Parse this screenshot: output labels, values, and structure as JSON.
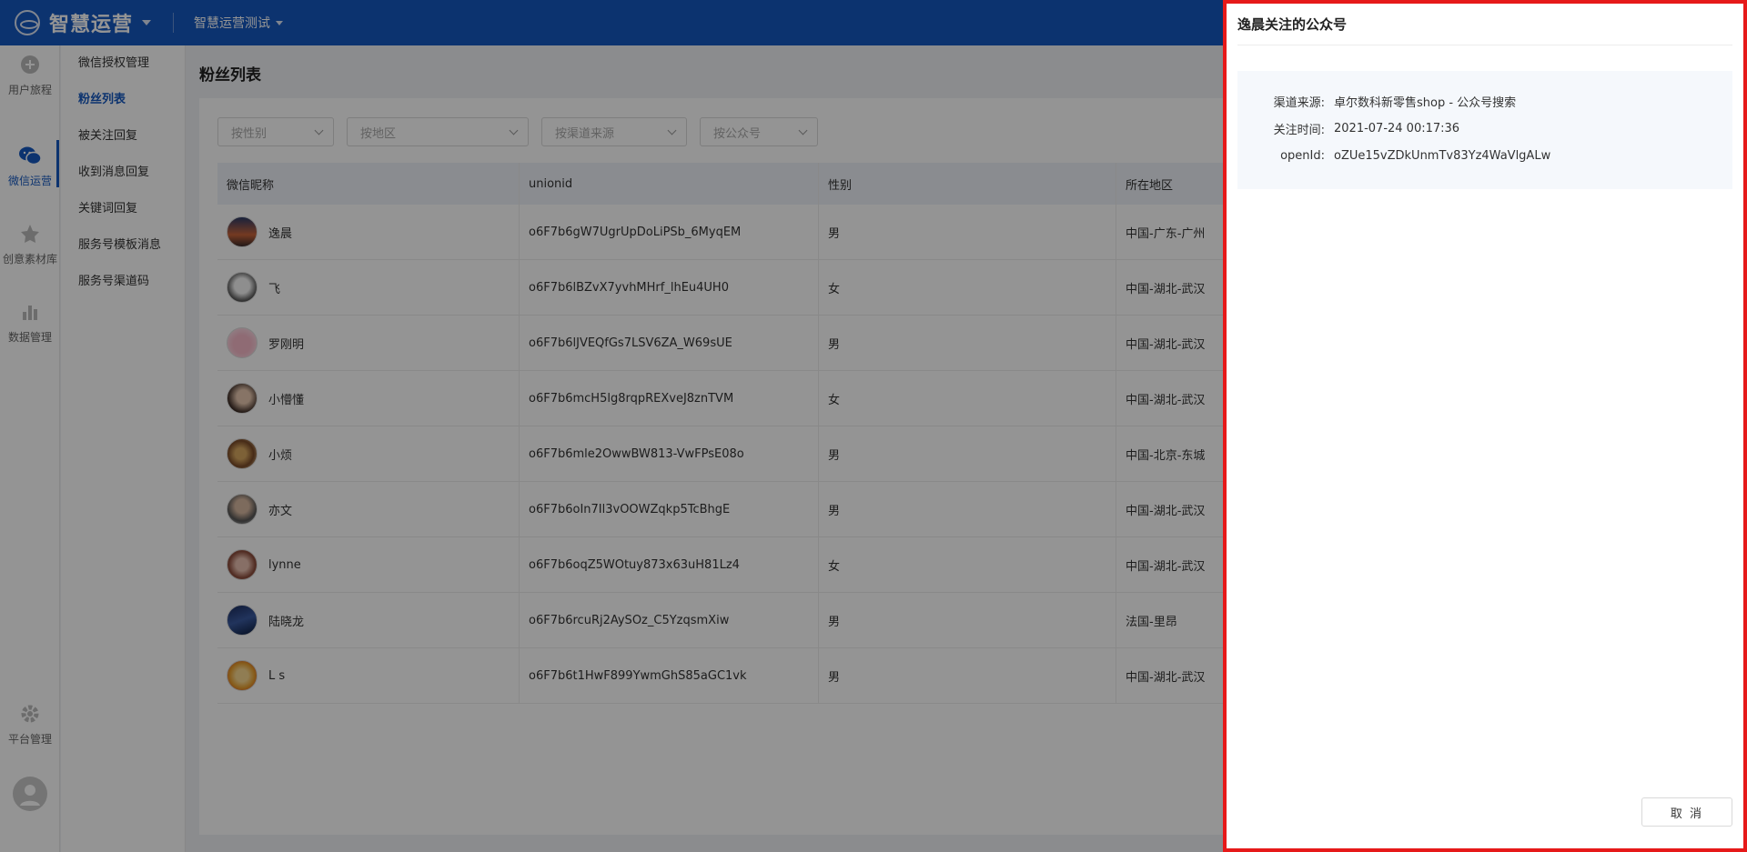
{
  "app": {
    "name": "智慧运营",
    "project": "智慧运营测试"
  },
  "rail": [
    {
      "label": "用户旅程",
      "icon": "journey-icon"
    },
    {
      "label": "微信运营",
      "icon": "wechat-icon",
      "active": true
    },
    {
      "label": "创意素材库",
      "icon": "creative-icon"
    },
    {
      "label": "数据管理",
      "icon": "bar-chart-icon"
    },
    {
      "label": "平台管理",
      "icon": "gear-icon"
    }
  ],
  "submenu": [
    {
      "label": "微信授权管理"
    },
    {
      "label": "粉丝列表",
      "active": true
    },
    {
      "label": "被关注回复"
    },
    {
      "label": "收到消息回复"
    },
    {
      "label": "关键词回复"
    },
    {
      "label": "服务号模板消息"
    },
    {
      "label": "服务号渠道码"
    }
  ],
  "page": {
    "title": "粉丝列表"
  },
  "filters": [
    {
      "placeholder": "按性别"
    },
    {
      "placeholder": "按地区"
    },
    {
      "placeholder": "按渠道来源"
    },
    {
      "placeholder": "按公众号"
    }
  ],
  "table": {
    "headers": [
      "微信昵称",
      "unionid",
      "性别",
      "所在地区"
    ],
    "rows": [
      {
        "name": "逸晨",
        "unionid": "o6F7b6gW7UgrUpDoLiPSb_6MyqEM",
        "gender": "男",
        "region": "中国-广东-广州"
      },
      {
        "name": "飞",
        "unionid": "o6F7b6lBZvX7yvhMHrf_lhEu4UH0",
        "gender": "女",
        "region": "中国-湖北-武汉"
      },
      {
        "name": "罗刚明",
        "unionid": "o6F7b6lJVEQfGs7LSV6ZA_W69sUE",
        "gender": "男",
        "region": "中国-湖北-武汉"
      },
      {
        "name": "小懵懂",
        "unionid": "o6F7b6mcH5lg8rqpREXveJ8znTVM",
        "gender": "女",
        "region": "中国-湖北-武汉"
      },
      {
        "name": "小烦",
        "unionid": "o6F7b6mle2OwwBW813-VwFPsE08o",
        "gender": "男",
        "region": "中国-北京-东城"
      },
      {
        "name": "亦文",
        "unionid": "o6F7b6oIn7Il3vOOWZqkp5TcBhgE",
        "gender": "男",
        "region": "中国-湖北-武汉"
      },
      {
        "name": "lynne",
        "unionid": "o6F7b6oqZ5WOtuy873x63uH81Lz4",
        "gender": "女",
        "region": "中国-湖北-武汉"
      },
      {
        "name": "陆晓龙",
        "unionid": "o6F7b6rcuRj2AySOz_C5YzqsmXiw",
        "gender": "男",
        "region": "法国-里昂"
      },
      {
        "name": "L s",
        "unionid": "o6F7b6t1HwF899YwmGhS85aGC1vk",
        "gender": "男",
        "region": "中国-湖北-武汉"
      }
    ]
  },
  "drawer": {
    "title": "逸晨关注的公众号",
    "info": [
      {
        "label": "渠道来源:",
        "value": "卓尔数科新零售shop - 公众号搜索"
      },
      {
        "label": "关注时间:",
        "value": "2021-07-24 00:17:36"
      },
      {
        "label": "openId:",
        "value": "oZUe15vZDkUnmTv83Yz4WaVlgALw"
      }
    ],
    "cancel_label": "取 消"
  },
  "colors": {
    "brand": "#1558c0",
    "highlight_border": "#e61919"
  }
}
